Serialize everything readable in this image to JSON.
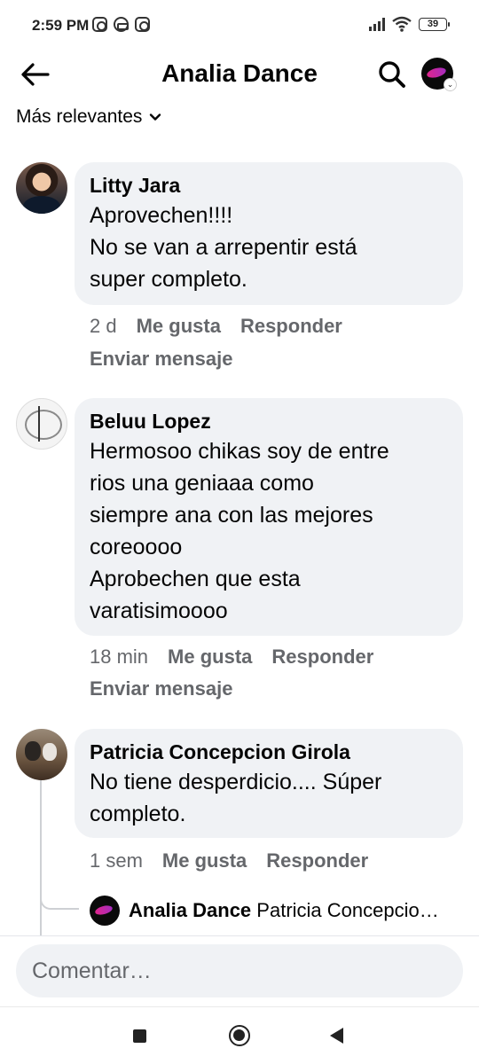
{
  "status_bar": {
    "time": "2:59 PM",
    "battery": "39"
  },
  "header": {
    "title": "Analia Dance"
  },
  "sort": {
    "label": "Más relevantes"
  },
  "comments": [
    {
      "author": "Litty Jara",
      "text": "Aprovechen!!!!\nNo se van a arrepentir está\nsuper completo.",
      "time": "2 d",
      "like": "Me gusta",
      "reply": "Responder",
      "message": "Enviar mensaje"
    },
    {
      "author": "Beluu Lopez",
      "text": "Hermosoo chikas soy de entre\nrios una geniaaa como\nsiempre ana con las mejores\ncoreoooo\nAprobechen que esta\nvaratisimoooo",
      "time": "18 min",
      "like": "Me gusta",
      "reply": "Responder",
      "message": "Enviar mensaje"
    },
    {
      "author": "Patricia Concepcion Girola",
      "text": "No tiene desperdicio.... Súper\ncompleto.",
      "time": "1 sem",
      "like": "Me gusta",
      "reply": "Responder"
    }
  ],
  "reply_preview": {
    "author": "Analia Dance",
    "text": "Patricia Concepcio…"
  },
  "composer": {
    "placeholder": "Comentar…"
  },
  "colors": {
    "bubble_bg": "#f0f2f5",
    "secondary_text": "#65676b",
    "brand_pink": "#e0248c"
  }
}
